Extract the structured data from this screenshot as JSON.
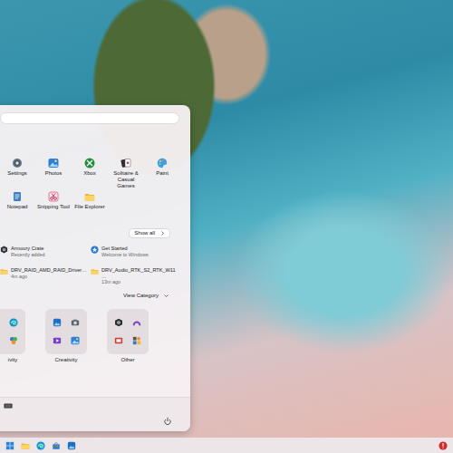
{
  "start_menu": {
    "pinned": [
      {
        "label": "Settings"
      },
      {
        "label": "Photos"
      },
      {
        "label": "Xbox"
      },
      {
        "label": "Solitaire & Casual Games"
      },
      {
        "label": "Paint"
      },
      {
        "label": "Notepad"
      },
      {
        "label": "Snipping Tool"
      },
      {
        "label": "File Explorer"
      }
    ],
    "show_all": {
      "label": "Show all"
    },
    "recommended": [
      {
        "title": "Armoury Crate",
        "subtitle": "Recently added"
      },
      {
        "title": "Get Started",
        "subtitle": "Welcome to Windows"
      },
      {
        "title": "DRV_RAID_AMD_RAID_Driver…",
        "subtitle": "4m ago"
      },
      {
        "title": "DRV_Audio_RTK_S2_RTK_W11…",
        "subtitle": "13m ago"
      }
    ],
    "view": {
      "label": "View Category"
    },
    "categories": [
      {
        "label": "ivity"
      },
      {
        "label": "Creativity"
      },
      {
        "label": "Other"
      }
    ]
  }
}
